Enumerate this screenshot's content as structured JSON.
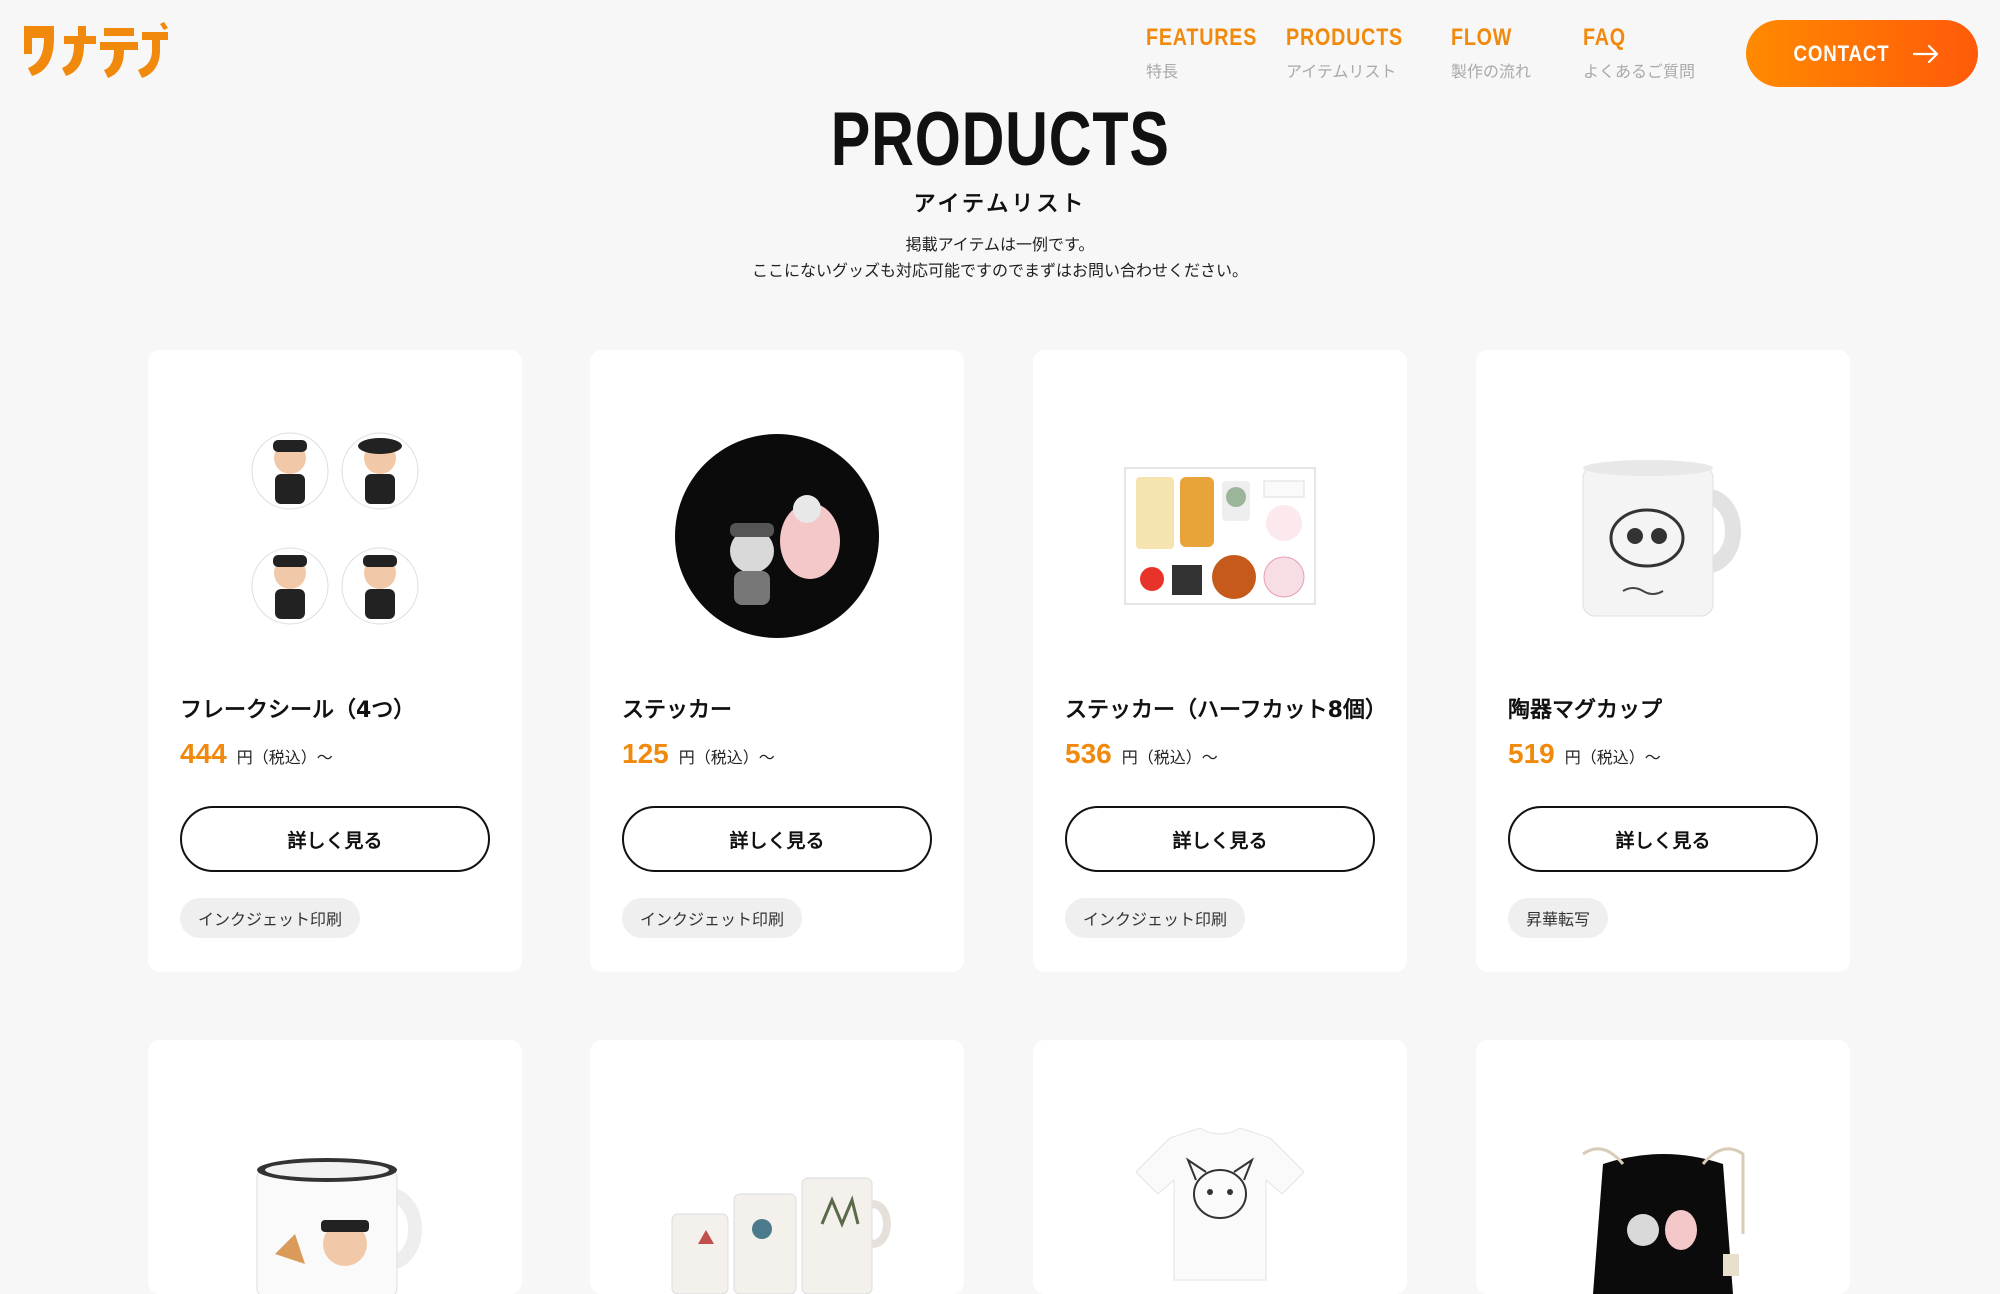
{
  "header": {
    "logo_text": "ワナテデ",
    "nav": [
      {
        "en": "FEATURES",
        "ja": "特長"
      },
      {
        "en": "PRODUCTS",
        "ja": "アイテムリスト"
      },
      {
        "en": "FLOW",
        "ja": "製作の流れ"
      },
      {
        "en": "FAQ",
        "ja": "よくあるご質問"
      }
    ],
    "contact_label": "CONTACT",
    "accent": "#f0890c"
  },
  "hero": {
    "title": "PRODUCTS",
    "subtitle": "アイテムリスト",
    "desc_line1": "掲載アイテムは一例です。",
    "desc_line2": "ここにないグッズも対応可能ですのでまずはお問い合わせください。"
  },
  "products": [
    {
      "name": "フレークシール（4つ）",
      "price": "444",
      "unit": "円（税込）〜",
      "button": "詳しく見る",
      "tag": "インクジェット印刷",
      "image": "flake-sticker-image"
    },
    {
      "name": "ステッカー",
      "price": "125",
      "unit": "円（税込）〜",
      "button": "詳しく見る",
      "tag": "インクジェット印刷",
      "image": "round-sticker-image"
    },
    {
      "name": "ステッカー（ハーフカット8個）",
      "price": "536",
      "unit": "円（税込）〜",
      "button": "詳しく見る",
      "tag": "インクジェット印刷",
      "image": "halfcut-sticker-sheet-image"
    },
    {
      "name": "陶器マグカップ",
      "price": "519",
      "unit": "円（税込）〜",
      "button": "詳しく見る",
      "tag": "昇華転写",
      "image": "ceramic-mug-image"
    }
  ],
  "products_row2": [
    {
      "image": "enamel-mug-image"
    },
    {
      "image": "mug-set-image"
    },
    {
      "image": "tshirt-image"
    },
    {
      "image": "drawstring-bag-image"
    }
  ]
}
